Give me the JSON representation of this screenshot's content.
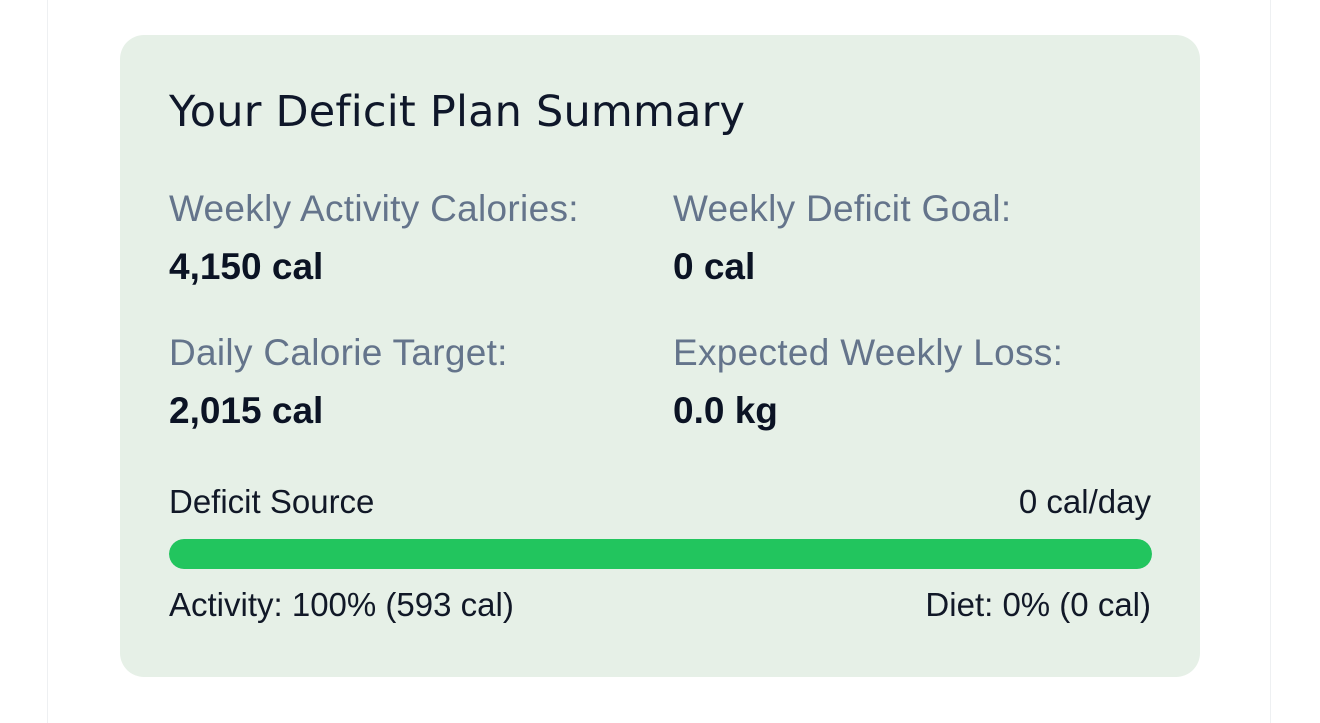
{
  "summary": {
    "title": "Your Deficit Plan Summary",
    "stats": [
      {
        "label": "Weekly Activity Calories:",
        "value": "4,150 cal"
      },
      {
        "label": "Weekly Deficit Goal:",
        "value": "0 cal"
      },
      {
        "label": "Daily Calorie Target:",
        "value": "2,015 cal"
      },
      {
        "label": "Expected Weekly Loss:",
        "value": "0.0 kg"
      }
    ],
    "deficit_source": {
      "label": "Deficit Source",
      "per_day": "0 cal/day",
      "activity_percent": 100,
      "activity_text": "Activity: 100% (593 cal)",
      "diet_text": "Diet: 0% (0 cal)"
    }
  },
  "colors": {
    "card_background": "#e6f0e7",
    "bar_fill": "#22c55e",
    "label_text": "#64748b",
    "value_text": "#0b1324"
  }
}
